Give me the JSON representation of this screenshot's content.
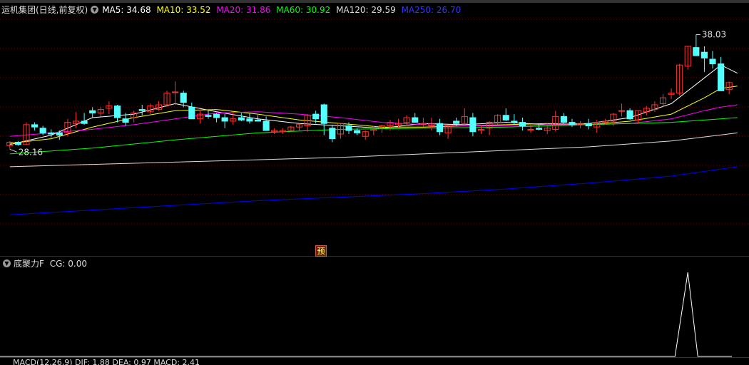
{
  "header": {
    "title": "运机集团(日线,前复权)",
    "ma": [
      {
        "label": "MA5: 34.68",
        "color": "#ffffff"
      },
      {
        "label": "MA10: 33.52",
        "color": "#ffff00"
      },
      {
        "label": "MA20: 31.86",
        "color": "#ff00ff"
      },
      {
        "label": "MA60: 30.92",
        "color": "#00ff00"
      },
      {
        "label": "MA120: 29.59",
        "color": "#dddddd"
      },
      {
        "label": "MA250: 26.70",
        "color": "#0000ff"
      }
    ]
  },
  "indicator": {
    "name": "底聚力F",
    "value_text": "CG: 0.00"
  },
  "macd": {
    "label": "MACD(12,26,9)  DIF: 1.88  DEA: 0.97  MACD: 2.41"
  },
  "badge": {
    "yu": "预"
  },
  "chart_data": {
    "type": "candlestick",
    "price_range": [
      19.5,
      39.5
    ],
    "annotations": {
      "high": "38.03",
      "low": "28.16"
    },
    "colors": {
      "up": "#ff3232",
      "down": "#54ffff",
      "grid": "#7a0000",
      "axis": "#a00000"
    },
    "candles": [
      [
        28.5,
        28.9,
        28.2,
        28.8
      ],
      [
        28.8,
        28.9,
        28.5,
        28.6
      ],
      [
        28.6,
        30.5,
        28.6,
        30.3
      ],
      [
        30.3,
        30.5,
        29.8,
        30.1
      ],
      [
        30.0,
        30.2,
        29.4,
        29.6
      ],
      [
        29.6,
        29.9,
        29.2,
        29.5
      ],
      [
        29.6,
        29.8,
        29.0,
        29.4
      ],
      [
        29.6,
        30.8,
        29.3,
        30.5
      ],
      [
        30.4,
        31.4,
        30.0,
        30.6
      ],
      [
        30.6,
        31.3,
        30.3,
        30.4
      ],
      [
        31.5,
        31.8,
        30.9,
        31.3
      ],
      [
        31.3,
        31.8,
        31.0,
        31.6
      ],
      [
        31.7,
        32.3,
        31.2,
        31.9
      ],
      [
        31.9,
        32.0,
        30.5,
        30.9
      ],
      [
        30.8,
        31.3,
        30.2,
        30.5
      ],
      [
        30.9,
        31.5,
        30.5,
        31.3
      ],
      [
        31.6,
        32.0,
        31.1,
        31.5
      ],
      [
        31.4,
        32.1,
        31.2,
        31.9
      ],
      [
        31.6,
        32.3,
        31.5,
        32.0
      ],
      [
        32.0,
        33.2,
        31.8,
        33.0
      ],
      [
        33.1,
        34.0,
        32.0,
        33.1
      ],
      [
        33.0,
        33.2,
        31.8,
        32.2
      ],
      [
        31.8,
        32.2,
        30.9,
        30.8
      ],
      [
        30.8,
        31.6,
        30.4,
        31.2
      ],
      [
        31.1,
        31.5,
        30.8,
        31.0
      ],
      [
        31.2,
        31.3,
        30.5,
        30.9
      ],
      [
        30.9,
        31.2,
        30.0,
        30.6
      ],
      [
        30.6,
        31.4,
        30.3,
        30.8
      ],
      [
        30.9,
        31.3,
        30.6,
        30.7
      ],
      [
        30.8,
        31.3,
        30.4,
        30.6
      ],
      [
        30.7,
        31.1,
        30.6,
        30.6
      ],
      [
        30.6,
        31.0,
        29.8,
        29.8
      ],
      [
        29.7,
        30.0,
        29.5,
        29.8
      ],
      [
        29.7,
        30.0,
        29.5,
        29.8
      ],
      [
        29.8,
        30.2,
        29.7,
        30.1
      ],
      [
        30.1,
        30.4,
        29.8,
        30.3
      ],
      [
        30.2,
        31.2,
        29.7,
        31.1
      ],
      [
        31.2,
        31.5,
        30.4,
        30.8
      ],
      [
        32.0,
        32.1,
        29.4,
        30.4
      ],
      [
        30.0,
        30.3,
        28.8,
        29.1
      ],
      [
        29.5,
        30.4,
        29.1,
        30.4
      ],
      [
        30.2,
        30.5,
        29.5,
        29.8
      ],
      [
        29.8,
        30.0,
        29.4,
        29.6
      ],
      [
        29.3,
        29.8,
        29.0,
        29.7
      ],
      [
        29.8,
        30.2,
        29.4,
        29.9
      ],
      [
        30.0,
        30.3,
        29.6,
        30.2
      ],
      [
        30.2,
        30.7,
        29.8,
        30.5
      ],
      [
        30.3,
        30.8,
        30.0,
        30.4
      ],
      [
        30.5,
        31.1,
        30.2,
        30.9
      ],
      [
        30.9,
        31.3,
        30.7,
        30.5
      ],
      [
        30.4,
        30.9,
        30.1,
        30.4
      ],
      [
        30.2,
        30.9,
        29.8,
        30.4
      ],
      [
        30.4,
        30.8,
        29.4,
        29.7
      ],
      [
        29.6,
        30.3,
        29.1,
        30.2
      ],
      [
        30.6,
        30.9,
        30.2,
        30.4
      ],
      [
        30.4,
        31.7,
        30.2,
        31.0
      ],
      [
        30.9,
        31.3,
        29.3,
        29.7
      ],
      [
        29.8,
        30.3,
        29.5,
        29.9
      ],
      [
        30.0,
        30.6,
        29.4,
        30.5
      ],
      [
        30.5,
        31.2,
        30.3,
        31.1
      ],
      [
        31.1,
        31.7,
        30.6,
        30.7
      ],
      [
        30.6,
        31.2,
        30.3,
        30.5
      ],
      [
        30.5,
        30.9,
        29.8,
        30.2
      ],
      [
        29.9,
        30.3,
        29.6,
        29.9
      ],
      [
        30.0,
        30.3,
        29.8,
        29.9
      ],
      [
        29.8,
        30.4,
        29.5,
        30.0
      ],
      [
        29.9,
        31.5,
        29.7,
        31.0
      ],
      [
        31.0,
        31.3,
        30.4,
        30.5
      ],
      [
        30.5,
        30.8,
        30.1,
        30.3
      ],
      [
        30.3,
        30.6,
        30.0,
        30.4
      ],
      [
        30.4,
        30.8,
        29.9,
        30.2
      ],
      [
        30.1,
        30.7,
        29.6,
        30.5
      ],
      [
        30.5,
        30.8,
        30.3,
        30.6
      ],
      [
        30.6,
        31.3,
        30.2,
        31.2
      ],
      [
        31.5,
        32.1,
        31.0,
        31.5
      ],
      [
        31.5,
        31.7,
        30.7,
        30.8
      ],
      [
        30.7,
        31.5,
        30.4,
        31.5
      ],
      [
        31.4,
        31.9,
        31.1,
        31.7
      ],
      [
        31.6,
        32.3,
        31.4,
        32.0
      ],
      [
        32.1,
        32.9,
        31.8,
        32.6
      ],
      [
        32.9,
        33.4,
        32.5,
        33.0
      ],
      [
        33.0,
        35.5,
        32.8,
        35.4
      ],
      [
        35.3,
        37.0,
        35.0,
        37.0
      ],
      [
        36.9,
        38.0,
        36.5,
        36.2
      ],
      [
        36.5,
        37.0,
        34.8,
        36.0
      ],
      [
        35.9,
        36.6,
        35.1,
        35.5
      ],
      [
        35.5,
        36.1,
        33.6,
        33.2
      ],
      [
        33.3,
        34.0,
        32.9,
        33.9
      ]
    ],
    "ma_lines": {
      "MA5": [
        [
          0,
          28.6
        ],
        [
          5,
          29.4
        ],
        [
          10,
          30.9
        ],
        [
          15,
          31.2
        ],
        [
          20,
          32.1
        ],
        [
          25,
          31.4
        ],
        [
          30,
          30.8
        ],
        [
          35,
          30.4
        ],
        [
          40,
          30.2
        ],
        [
          45,
          30.0
        ],
        [
          50,
          30.4
        ],
        [
          55,
          30.3
        ],
        [
          60,
          30.5
        ],
        [
          65,
          30.3
        ],
        [
          70,
          30.4
        ],
        [
          75,
          30.9
        ],
        [
          80,
          32.1
        ],
        [
          84,
          34.3
        ],
        [
          86,
          35.4
        ],
        [
          88,
          34.7
        ]
      ],
      "MA10": [
        [
          0,
          28.7
        ],
        [
          5,
          29.1
        ],
        [
          10,
          30.1
        ],
        [
          15,
          30.9
        ],
        [
          20,
          31.5
        ],
        [
          25,
          31.6
        ],
        [
          30,
          31.2
        ],
        [
          35,
          30.7
        ],
        [
          40,
          30.4
        ],
        [
          45,
          30.1
        ],
        [
          50,
          30.1
        ],
        [
          55,
          30.2
        ],
        [
          60,
          30.3
        ],
        [
          65,
          30.4
        ],
        [
          70,
          30.3
        ],
        [
          75,
          30.6
        ],
        [
          80,
          31.2
        ],
        [
          84,
          32.6
        ],
        [
          86,
          33.4
        ],
        [
          88,
          33.6
        ]
      ],
      "MA20": [
        [
          0,
          29.3
        ],
        [
          5,
          29.6
        ],
        [
          10,
          29.9
        ],
        [
          15,
          30.3
        ],
        [
          20,
          30.8
        ],
        [
          25,
          31.3
        ],
        [
          30,
          31.4
        ],
        [
          35,
          31.2
        ],
        [
          40,
          30.9
        ],
        [
          45,
          30.5
        ],
        [
          50,
          30.3
        ],
        [
          55,
          30.2
        ],
        [
          60,
          30.2
        ],
        [
          65,
          30.3
        ],
        [
          70,
          30.3
        ],
        [
          75,
          30.4
        ],
        [
          80,
          30.8
        ],
        [
          84,
          31.5
        ],
        [
          86,
          31.8
        ],
        [
          88,
          32.0
        ]
      ],
      "MA60": [
        [
          0,
          27.8
        ],
        [
          10,
          28.3
        ],
        [
          20,
          29.0
        ],
        [
          30,
          29.6
        ],
        [
          40,
          29.9
        ],
        [
          50,
          30.0
        ],
        [
          60,
          30.1
        ],
        [
          70,
          30.3
        ],
        [
          80,
          30.5
        ],
        [
          88,
          30.9
        ]
      ],
      "MA120": [
        [
          0,
          26.7
        ],
        [
          10,
          26.9
        ],
        [
          20,
          27.1
        ],
        [
          30,
          27.3
        ],
        [
          40,
          27.5
        ],
        [
          50,
          27.8
        ],
        [
          60,
          28.1
        ],
        [
          70,
          28.4
        ],
        [
          80,
          28.9
        ],
        [
          88,
          29.6
        ]
      ],
      "MA250": [
        [
          0,
          22.6
        ],
        [
          10,
          23.0
        ],
        [
          20,
          23.4
        ],
        [
          30,
          23.8
        ],
        [
          40,
          24.1
        ],
        [
          50,
          24.4
        ],
        [
          60,
          24.8
        ],
        [
          70,
          25.3
        ],
        [
          80,
          25.9
        ],
        [
          88,
          26.7
        ]
      ]
    },
    "cg": {
      "peak_index": 82,
      "peak_value": 1,
      "others": 0
    }
  }
}
